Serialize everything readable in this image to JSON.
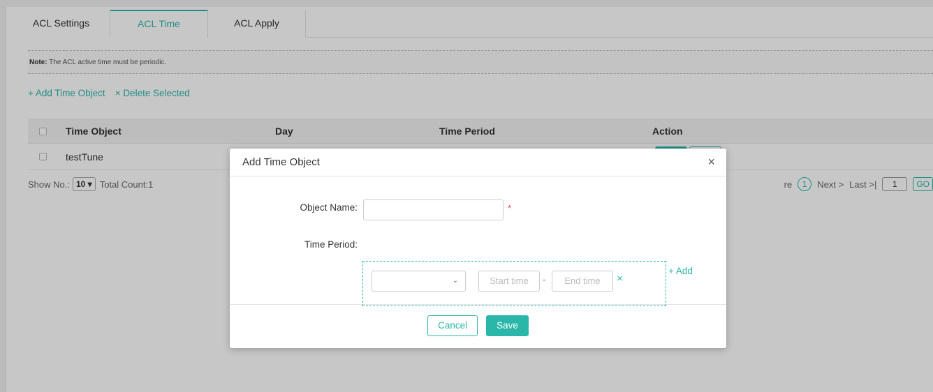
{
  "tabs": [
    "ACL Settings",
    "ACL Time",
    "ACL Apply"
  ],
  "note": {
    "label": "Note:",
    "text": "The ACL active time must be periodic."
  },
  "toolbar": {
    "add": "+ Add Time Object",
    "delete": "× Delete Selected"
  },
  "table": {
    "headers": [
      "Time Object",
      "Day",
      "Time Period",
      "Action"
    ],
    "rows": [
      {
        "name": "testTune"
      }
    ]
  },
  "pager": {
    "show_label": "Show No.:",
    "page_size": "10 ▾",
    "total": "Total Count:1",
    "prev": "re",
    "current": "1",
    "next": "Next >",
    "last": "Last >|",
    "goto": "1",
    "go": "GO"
  },
  "modal": {
    "title": "Add Time Object",
    "close": "×",
    "object_name_label": "Object Name:",
    "object_name_value": "",
    "required": "*",
    "time_period_label": "Time Period:",
    "select_value": "",
    "start_placeholder": "Start time",
    "separator": "-",
    "end_placeholder": "End time",
    "remove": "×",
    "add": "+ Add",
    "cancel": "Cancel",
    "save": "Save"
  },
  "colors": {
    "accent": "#2ab7a9",
    "required": "#e64b4b"
  }
}
